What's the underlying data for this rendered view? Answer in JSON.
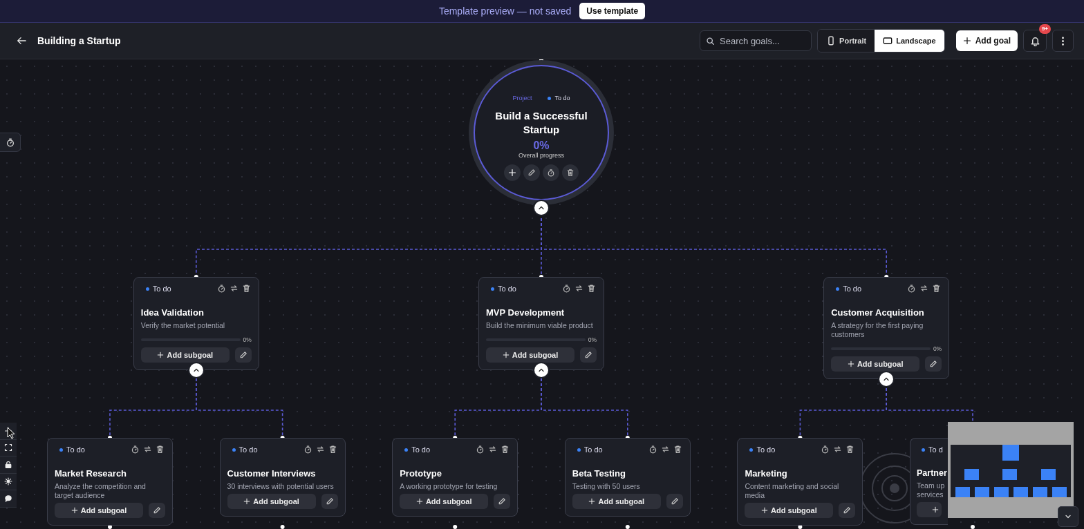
{
  "banner": {
    "text": "Template preview — not saved",
    "button": "Use template"
  },
  "header": {
    "title": "Building a Startup",
    "search": {
      "placeholder": "Search goals..."
    },
    "notifications_badge": "9+",
    "add_button": "Add goal",
    "orientation": [
      {
        "label": "Portrait",
        "selected": false
      },
      {
        "label": "Landscape",
        "selected": true
      }
    ]
  },
  "root": {
    "type_label": "Project",
    "status": "To do",
    "title": "Build a Successful Startup",
    "progress": "0%",
    "progress_label": "Overall progress",
    "expanded": true
  },
  "goals": [
    {
      "status": "To do",
      "title": "Idea Validation",
      "description": "Verify the market potential",
      "progress": "0%",
      "level": 0,
      "add_label": "Add subgoal",
      "expanded": true,
      "children": [
        {
          "status": "To do",
          "title": "Market Research",
          "description": "Analyze the competition and target audience",
          "add_label": "Add subgoal"
        },
        {
          "status": "To do",
          "title": "Customer Interviews",
          "description": "30 interviews with potential users",
          "add_label": "Add subgoal"
        }
      ]
    },
    {
      "status": "To do",
      "title": "MVP Development",
      "description": "Build the minimum viable product",
      "progress": "0%",
      "level": 0,
      "add_label": "Add subgoal",
      "expanded": true,
      "children": [
        {
          "status": "To do",
          "title": "Prototype",
          "description": "A working prototype for testing",
          "add_label": "Add subgoal"
        },
        {
          "status": "To do",
          "title": "Beta Testing",
          "description": "Testing with 50 users",
          "add_label": "Add subgoal"
        }
      ]
    },
    {
      "status": "To do",
      "title": "Customer Acquisition",
      "description": "A strategy for the first paying customers",
      "progress": "0%",
      "level": 0,
      "add_label": "Add subgoal",
      "expanded": true,
      "children": [
        {
          "status": "To do",
          "title": "Marketing",
          "description": "Content marketing and social media",
          "add_label": "Add subgoal"
        },
        {
          "status": "To d",
          "title": "Partner",
          "description": "Team up\nservices",
          "clipped": true
        }
      ]
    }
  ]
}
